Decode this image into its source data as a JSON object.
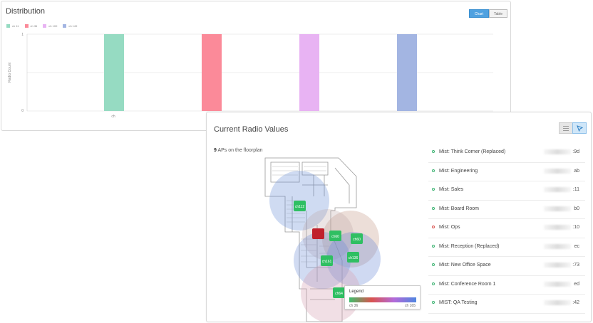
{
  "distribution": {
    "title": "Distribution",
    "chart_button": "Chart",
    "table_button": "Table",
    "chart_data": {
      "type": "bar",
      "title": "Distribution",
      "xlabel": "",
      "ylabel": "Radio Count",
      "categories": [
        "ch"
      ],
      "ylim": [
        0,
        1
      ],
      "y_ticks": [
        "0",
        "1"
      ],
      "x_tick": "ch",
      "grid": true,
      "legend_position": "top-left",
      "series": [
        {
          "name": "ch 11",
          "value": 1,
          "color": "#96dbc2"
        },
        {
          "name": "ch 36",
          "value": 1,
          "color": "#fb8a99"
        },
        {
          "name": "ch 100",
          "value": 1,
          "color": "#e8b3f3"
        },
        {
          "name": "ch 149",
          "value": 1,
          "color": "#a3b5e2"
        }
      ]
    }
  },
  "radio": {
    "title": "Current Radio Values",
    "list_icon": "list-icon",
    "map_icon": "map-cursor-icon",
    "ap_count": "9",
    "ap_count_label": "APs on the floorplan",
    "map_legend": {
      "title": "Legend",
      "min_label": "ch 36",
      "max_label": "ch 165"
    },
    "ap_markers": [
      "ch112",
      "ch60",
      "ch60",
      "ch161",
      "ch136",
      "ch64"
    ],
    "aps": [
      {
        "name": "Mist: Think Corner (Replaced)",
        "mac_suffix": ":9d",
        "status": "green"
      },
      {
        "name": "Mist: Engineering",
        "mac_suffix": "ab",
        "status": "green"
      },
      {
        "name": "Mist: Sales",
        "mac_suffix": ":11",
        "status": "green"
      },
      {
        "name": "Mist: Board Room",
        "mac_suffix": "b0",
        "status": "green"
      },
      {
        "name": "Mist: Ops",
        "mac_suffix": ":10",
        "status": "red"
      },
      {
        "name": "Mist: Reception (Replaced)",
        "mac_suffix": "ec",
        "status": "green"
      },
      {
        "name": "Mist: New Office Space",
        "mac_suffix": ":73",
        "status": "green"
      },
      {
        "name": "Mist: Conference Room 1",
        "mac_suffix": "ed",
        "status": "green"
      },
      {
        "name": "MIST: QA Testing",
        "mac_suffix": ":42",
        "status": "green"
      }
    ]
  }
}
